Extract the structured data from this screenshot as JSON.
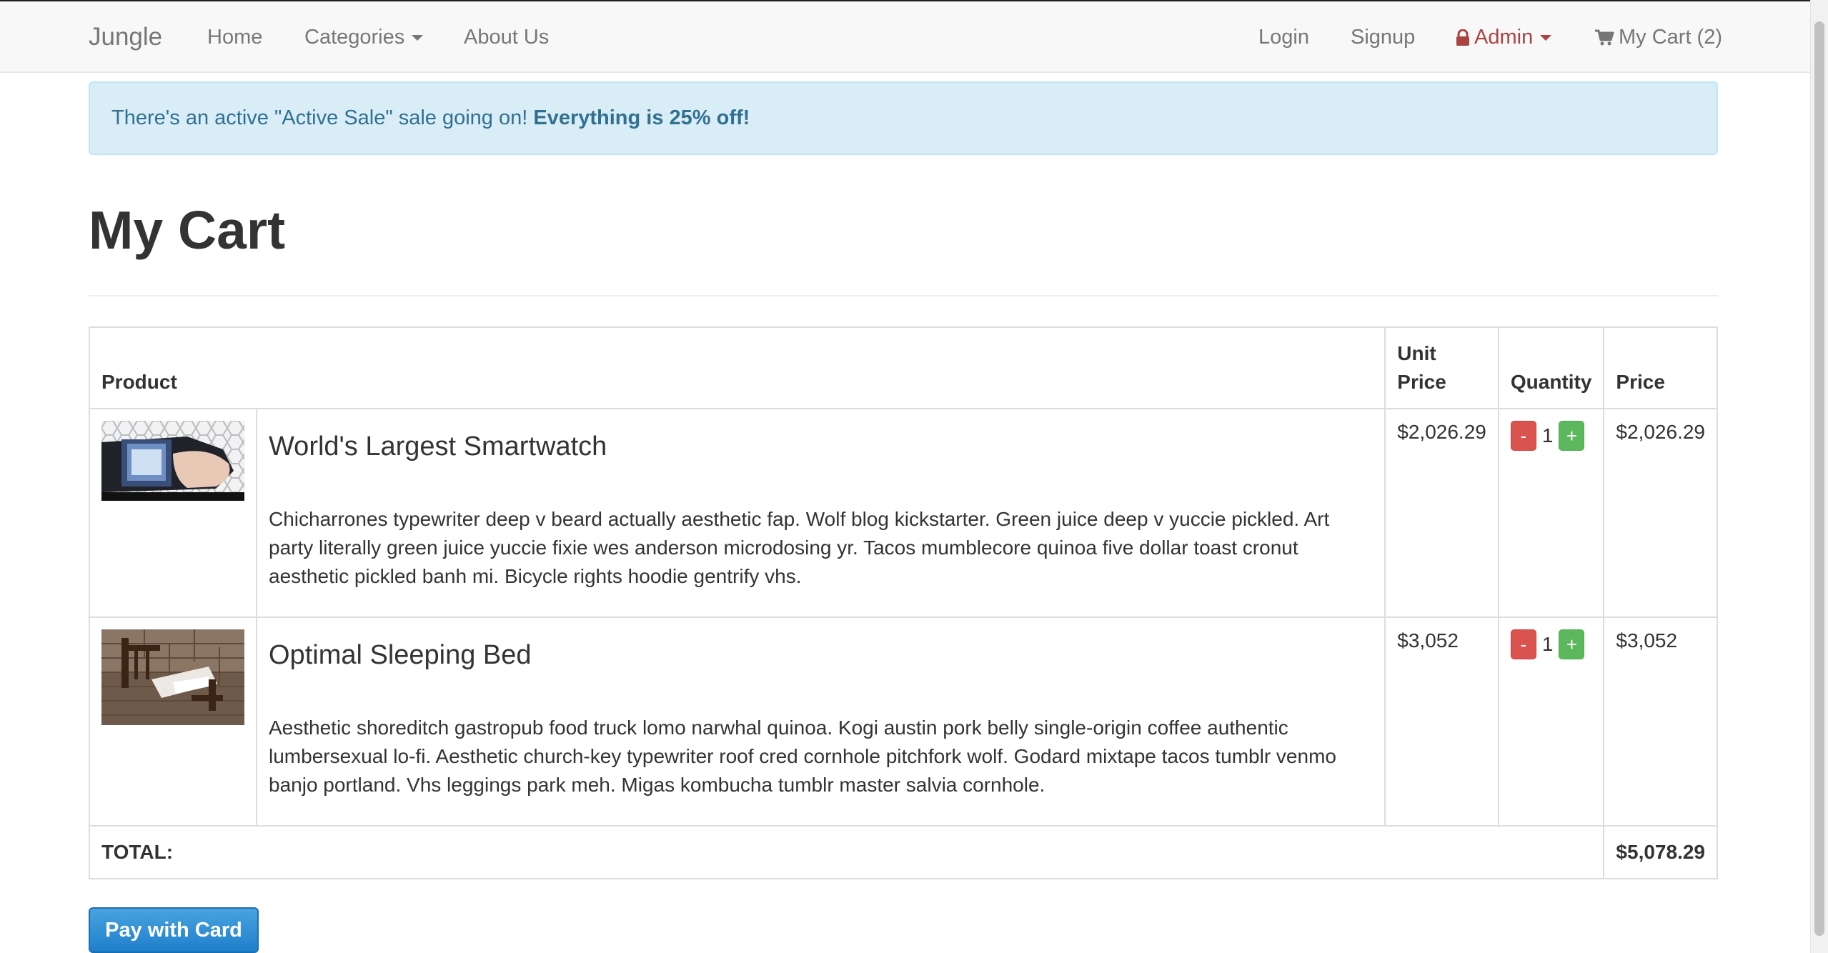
{
  "navbar": {
    "brand": "Jungle",
    "links": {
      "home": "Home",
      "categories": "Categories",
      "about": "About Us"
    },
    "right": {
      "login": "Login",
      "signup": "Signup",
      "admin": "Admin",
      "cart": "My Cart (2)"
    },
    "icons": {
      "admin": "lock-icon",
      "cart": "shopping-cart-icon"
    },
    "colors": {
      "admin": "#a94442"
    }
  },
  "alert": {
    "text": "There's an active \"Active Sale\" sale going on! ",
    "emphasis": "Everything is 25% off!"
  },
  "page_title": "My Cart",
  "cart": {
    "headers": {
      "product": "Product",
      "unit_price": "Unit Price",
      "quantity": "Quantity",
      "price": "Price"
    },
    "items": [
      {
        "name": "World's Largest Smartwatch",
        "description": "Chicharrones typewriter deep v beard actually aesthetic fap. Wolf blog kickstarter. Green juice deep v yuccie pickled. Art party literally green juice yuccie fixie wes anderson microdosing yr. Tacos mumblecore quinoa five dollar toast cronut aesthetic pickled banh mi. Bicycle rights hoodie gentrify vhs.",
        "unit_price": "$2,026.29",
        "quantity": "1",
        "price": "$2,026.29",
        "image": "smartwatch-photo"
      },
      {
        "name": "Optimal Sleeping Bed",
        "description": "Aesthetic shoreditch gastropub food truck lomo narwhal quinoa. Kogi austin pork belly single-origin coffee authentic lumbersexual lo-fi. Aesthetic church-key typewriter roof cred cornhole pitchfork wolf. Godard mixtape tacos tumblr venmo banjo portland. Vhs leggings park meh. Migas kombucha tumblr master salvia cornhole.",
        "unit_price": "$3,052",
        "quantity": "1",
        "price": "$3,052",
        "image": "bed-photo"
      }
    ],
    "buttons": {
      "decrease": "-",
      "increase": "+"
    },
    "total_label": "TOTAL:",
    "total_value": "$5,078.29"
  },
  "pay_button": "Pay with Card"
}
